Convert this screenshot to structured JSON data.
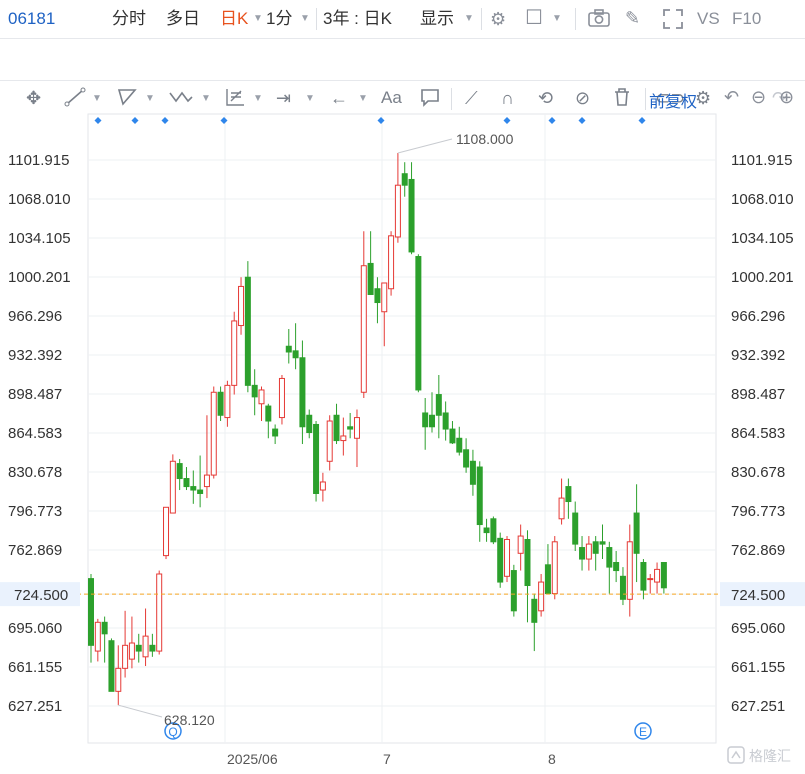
{
  "toolbar": {
    "code": "06181",
    "tabs": [
      "分时",
      "多日",
      "日K",
      "1分"
    ],
    "active_tab": "日K",
    "range": "3年 : 日K",
    "show": "显示",
    "vs": "VS",
    "f10": "F10",
    "adjust": "前复权"
  },
  "icons": {
    "row1": [
      "settings-icon",
      "color-square-icon",
      "camera-icon",
      "pencil-icon",
      "expand-icon"
    ],
    "row2": [
      "crosshair-icon",
      "line-draw-icon",
      "shape-draw-icon",
      "wave-icon",
      "grid-measure-icon",
      "span-icon",
      "arrow-left-icon",
      "text-icon",
      "comment-icon",
      "ruler-icon",
      "magnet-icon",
      "lock-sync-icon",
      "eye-off-icon",
      "trash-icon",
      "compare-icon",
      "gear-icon",
      "redo-icon"
    ],
    "zoom": [
      "reset-icon",
      "zoom-out-icon",
      "zoom-in-icon"
    ]
  },
  "chart_data": {
    "type": "candlestick",
    "y_ticks": [
      "1101.915",
      "1068.010",
      "1034.105",
      "1000.201",
      "966.296",
      "932.392",
      "898.487",
      "864.583",
      "830.678",
      "796.773",
      "762.869",
      "724.500",
      "695.060",
      "661.155",
      "627.251"
    ],
    "x_labels": [
      "2025/06",
      "7",
      "8"
    ],
    "current_price": "724.500",
    "max_label": "1108.000",
    "min_label": "628.120",
    "event_markers": [
      "Q",
      "E"
    ],
    "colors": {
      "up": "#e53935",
      "down": "#2ca02c",
      "price_line": "#f5a623",
      "grid": "#eef0f3",
      "marker": "#2f86eb"
    },
    "candles": [
      {
        "o": 738,
        "h": 742,
        "l": 665,
        "c": 680
      },
      {
        "o": 675,
        "h": 703,
        "l": 666,
        "c": 700
      },
      {
        "o": 700,
        "h": 705,
        "l": 665,
        "c": 690
      },
      {
        "o": 684,
        "h": 686,
        "l": 640,
        "c": 640
      },
      {
        "o": 640,
        "h": 680,
        "l": 628,
        "c": 660
      },
      {
        "o": 660,
        "h": 710,
        "l": 652,
        "c": 680
      },
      {
        "o": 668,
        "h": 705,
        "l": 660,
        "c": 682
      },
      {
        "o": 680,
        "h": 690,
        "l": 665,
        "c": 675
      },
      {
        "o": 670,
        "h": 712,
        "l": 662,
        "c": 688
      },
      {
        "o": 680,
        "h": 690,
        "l": 670,
        "c": 675
      },
      {
        "o": 675,
        "h": 745,
        "l": 672,
        "c": 742
      },
      {
        "o": 758,
        "h": 800,
        "l": 755,
        "c": 800
      },
      {
        "o": 795,
        "h": 846,
        "l": 795,
        "c": 840
      },
      {
        "o": 838,
        "h": 842,
        "l": 815,
        "c": 825
      },
      {
        "o": 825,
        "h": 835,
        "l": 815,
        "c": 818
      },
      {
        "o": 818,
        "h": 832,
        "l": 803,
        "c": 815
      },
      {
        "o": 815,
        "h": 845,
        "l": 800,
        "c": 812
      },
      {
        "o": 818,
        "h": 880,
        "l": 808,
        "c": 828
      },
      {
        "o": 828,
        "h": 905,
        "l": 825,
        "c": 900
      },
      {
        "o": 900,
        "h": 905,
        "l": 875,
        "c": 880
      },
      {
        "o": 878,
        "h": 910,
        "l": 870,
        "c": 906
      },
      {
        "o": 906,
        "h": 970,
        "l": 898,
        "c": 962
      },
      {
        "o": 958,
        "h": 1000,
        "l": 950,
        "c": 992
      },
      {
        "o": 1000,
        "h": 1014,
        "l": 900,
        "c": 906
      },
      {
        "o": 906,
        "h": 920,
        "l": 880,
        "c": 896
      },
      {
        "o": 890,
        "h": 905,
        "l": 875,
        "c": 902
      },
      {
        "o": 888,
        "h": 890,
        "l": 860,
        "c": 875
      },
      {
        "o": 868,
        "h": 872,
        "l": 855,
        "c": 862
      },
      {
        "o": 878,
        "h": 915,
        "l": 872,
        "c": 912
      },
      {
        "o": 940,
        "h": 955,
        "l": 925,
        "c": 935
      },
      {
        "o": 936,
        "h": 960,
        "l": 920,
        "c": 930
      },
      {
        "o": 930,
        "h": 945,
        "l": 855,
        "c": 870
      },
      {
        "o": 880,
        "h": 885,
        "l": 860,
        "c": 865
      },
      {
        "o": 872,
        "h": 875,
        "l": 805,
        "c": 812
      },
      {
        "o": 815,
        "h": 830,
        "l": 805,
        "c": 822
      },
      {
        "o": 840,
        "h": 880,
        "l": 832,
        "c": 875
      },
      {
        "o": 880,
        "h": 890,
        "l": 855,
        "c": 858
      },
      {
        "o": 858,
        "h": 878,
        "l": 845,
        "c": 862
      },
      {
        "o": 870,
        "h": 882,
        "l": 860,
        "c": 868
      },
      {
        "o": 860,
        "h": 885,
        "l": 835,
        "c": 878
      },
      {
        "o": 900,
        "h": 1040,
        "l": 895,
        "c": 1010
      },
      {
        "o": 1012,
        "h": 1040,
        "l": 985,
        "c": 985
      },
      {
        "o": 990,
        "h": 1000,
        "l": 960,
        "c": 978
      },
      {
        "o": 970,
        "h": 995,
        "l": 940,
        "c": 995
      },
      {
        "o": 990,
        "h": 1040,
        "l": 984,
        "c": 1036
      },
      {
        "o": 1035,
        "h": 1108,
        "l": 1030,
        "c": 1080
      },
      {
        "o": 1090,
        "h": 1100,
        "l": 1070,
        "c": 1080
      },
      {
        "o": 1085,
        "h": 1100,
        "l": 1020,
        "c": 1022
      },
      {
        "o": 1018,
        "h": 1020,
        "l": 900,
        "c": 902
      },
      {
        "o": 882,
        "h": 895,
        "l": 850,
        "c": 870
      },
      {
        "o": 880,
        "h": 900,
        "l": 865,
        "c": 870
      },
      {
        "o": 898,
        "h": 915,
        "l": 860,
        "c": 880
      },
      {
        "o": 882,
        "h": 892,
        "l": 858,
        "c": 868
      },
      {
        "o": 868,
        "h": 875,
        "l": 855,
        "c": 856
      },
      {
        "o": 860,
        "h": 870,
        "l": 845,
        "c": 848
      },
      {
        "o": 850,
        "h": 860,
        "l": 830,
        "c": 835
      },
      {
        "o": 840,
        "h": 850,
        "l": 810,
        "c": 820
      },
      {
        "o": 835,
        "h": 840,
        "l": 770,
        "c": 785
      },
      {
        "o": 782,
        "h": 790,
        "l": 770,
        "c": 778
      },
      {
        "o": 790,
        "h": 792,
        "l": 768,
        "c": 770
      },
      {
        "o": 773,
        "h": 778,
        "l": 730,
        "c": 735
      },
      {
        "o": 740,
        "h": 775,
        "l": 735,
        "c": 772
      },
      {
        "o": 745,
        "h": 750,
        "l": 705,
        "c": 710
      },
      {
        "o": 760,
        "h": 785,
        "l": 745,
        "c": 775
      },
      {
        "o": 772,
        "h": 780,
        "l": 700,
        "c": 732
      },
      {
        "o": 720,
        "h": 725,
        "l": 675,
        "c": 700
      },
      {
        "o": 710,
        "h": 742,
        "l": 705,
        "c": 735
      },
      {
        "o": 750,
        "h": 768,
        "l": 745,
        "c": 725
      },
      {
        "o": 725,
        "h": 775,
        "l": 720,
        "c": 770
      },
      {
        "o": 790,
        "h": 825,
        "l": 785,
        "c": 808
      },
      {
        "o": 818,
        "h": 825,
        "l": 790,
        "c": 805
      },
      {
        "o": 795,
        "h": 805,
        "l": 762,
        "c": 768
      },
      {
        "o": 765,
        "h": 775,
        "l": 745,
        "c": 755
      },
      {
        "o": 755,
        "h": 775,
        "l": 745,
        "c": 768
      },
      {
        "o": 770,
        "h": 775,
        "l": 745,
        "c": 760
      },
      {
        "o": 770,
        "h": 785,
        "l": 755,
        "c": 768
      },
      {
        "o": 765,
        "h": 770,
        "l": 725,
        "c": 748
      },
      {
        "o": 752,
        "h": 762,
        "l": 735,
        "c": 745
      },
      {
        "o": 740,
        "h": 748,
        "l": 715,
        "c": 720
      },
      {
        "o": 720,
        "h": 785,
        "l": 705,
        "c": 770
      },
      {
        "o": 795,
        "h": 820,
        "l": 735,
        "c": 760
      },
      {
        "o": 752,
        "h": 755,
        "l": 720,
        "c": 728
      },
      {
        "o": 738,
        "h": 742,
        "l": 725,
        "c": 738
      },
      {
        "o": 735,
        "h": 752,
        "l": 725,
        "c": 746
      },
      {
        "o": 752,
        "h": 752,
        "l": 725,
        "c": 730
      }
    ]
  }
}
